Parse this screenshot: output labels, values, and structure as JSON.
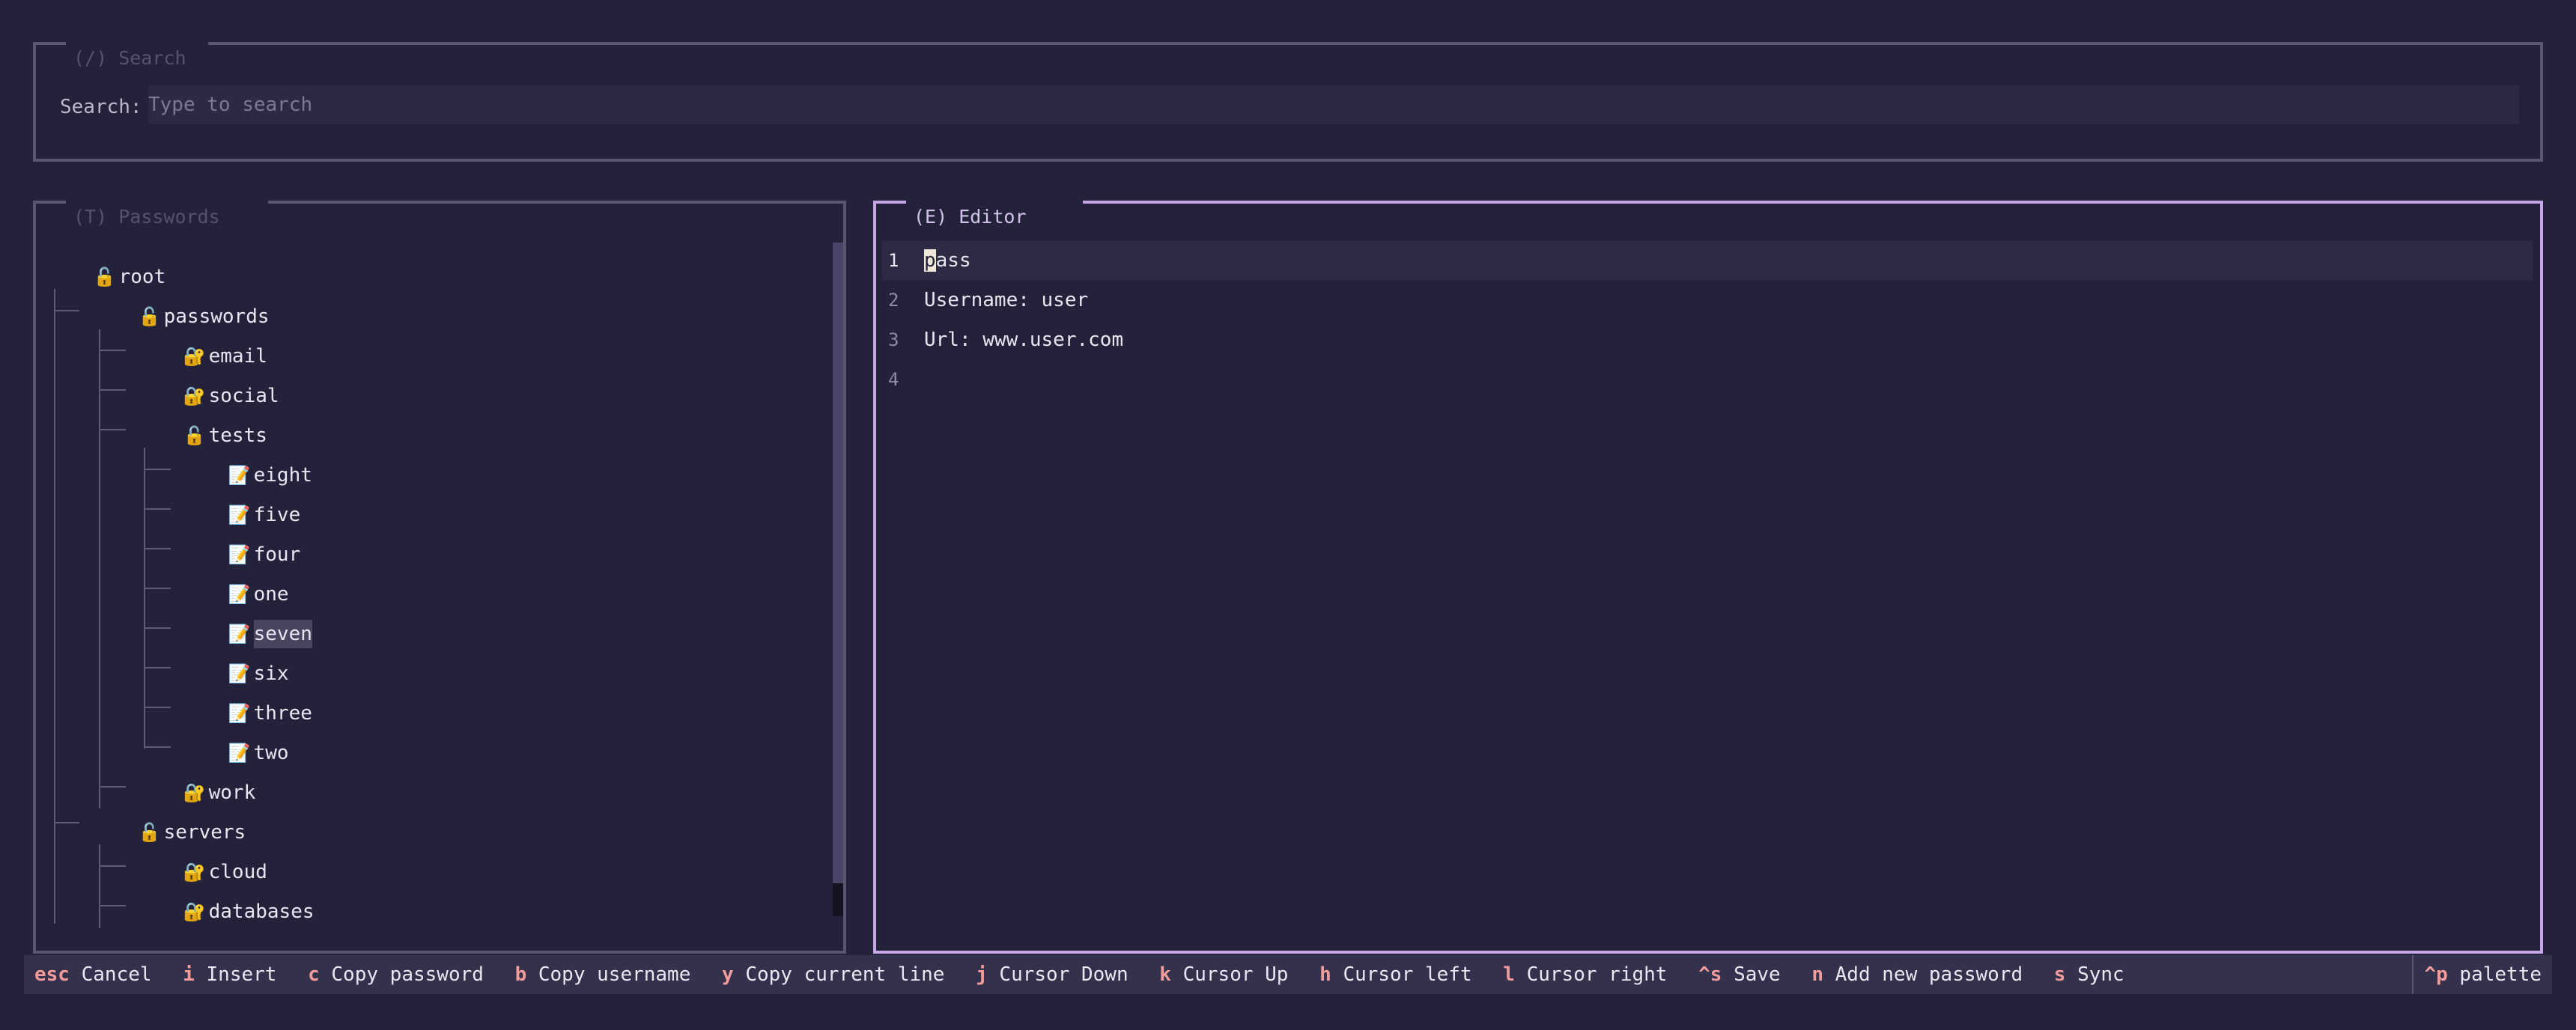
{
  "search": {
    "title": "(/) Search",
    "label": "Search:",
    "placeholder": "Type to search"
  },
  "passwords": {
    "title": "(T) Passwords",
    "tree": [
      {
        "label": "root",
        "icon": "🔓",
        "icon_name": "unlocked-folder-icon"
      },
      {
        "label": "passwords",
        "icon": "🔓",
        "icon_name": "unlocked-folder-icon"
      },
      {
        "label": "email",
        "icon": "🔐",
        "icon_name": "locked-folder-icon"
      },
      {
        "label": "social",
        "icon": "🔐",
        "icon_name": "locked-folder-icon"
      },
      {
        "label": "tests",
        "icon": "🔓",
        "icon_name": "unlocked-folder-icon"
      },
      {
        "label": "eight",
        "icon": "📝",
        "icon_name": "memo-icon"
      },
      {
        "label": "five",
        "icon": "📝",
        "icon_name": "memo-icon"
      },
      {
        "label": "four",
        "icon": "📝",
        "icon_name": "memo-icon"
      },
      {
        "label": "one",
        "icon": "📝",
        "icon_name": "memo-icon"
      },
      {
        "label": "seven",
        "icon": "📝",
        "icon_name": "memo-icon",
        "selected": true
      },
      {
        "label": "six",
        "icon": "📝",
        "icon_name": "memo-icon"
      },
      {
        "label": "three",
        "icon": "📝",
        "icon_name": "memo-icon"
      },
      {
        "label": "two",
        "icon": "📝",
        "icon_name": "memo-icon"
      },
      {
        "label": "work",
        "icon": "🔐",
        "icon_name": "locked-folder-icon"
      },
      {
        "label": "servers",
        "icon": "🔓",
        "icon_name": "unlocked-folder-icon"
      },
      {
        "label": "cloud",
        "icon": "🔐",
        "icon_name": "locked-folder-icon"
      },
      {
        "label": "databases",
        "icon": "🔐",
        "icon_name": "locked-folder-icon"
      }
    ]
  },
  "editor": {
    "title": "(E) Editor",
    "lines": [
      {
        "num": "1",
        "first_char": "p",
        "rest": "ass"
      },
      {
        "num": "2",
        "text": "Username: user"
      },
      {
        "num": "3",
        "text": "Url: www.user.com"
      },
      {
        "num": "4",
        "text": ""
      }
    ]
  },
  "footer": {
    "bindings": [
      {
        "key": "esc",
        "desc": "Cancel"
      },
      {
        "key": "i",
        "desc": "Insert"
      },
      {
        "key": "c",
        "desc": "Copy password"
      },
      {
        "key": "b",
        "desc": "Copy username"
      },
      {
        "key": "y",
        "desc": "Copy current line"
      },
      {
        "key": "j",
        "desc": "Cursor Down"
      },
      {
        "key": "k",
        "desc": "Cursor Up"
      },
      {
        "key": "h",
        "desc": "Cursor left"
      },
      {
        "key": "l",
        "desc": "Cursor right"
      },
      {
        "key": "^s",
        "desc": "Save"
      },
      {
        "key": "n",
        "desc": "Add new password"
      },
      {
        "key": "s",
        "desc": "Sync"
      }
    ],
    "palette_key": "^p",
    "palette_label": "palette"
  },
  "colors": {
    "background": "#24223a",
    "active_border": "#c6a7e8",
    "inactive_border": "#5b5570",
    "key_accent": "#f29b9b"
  }
}
